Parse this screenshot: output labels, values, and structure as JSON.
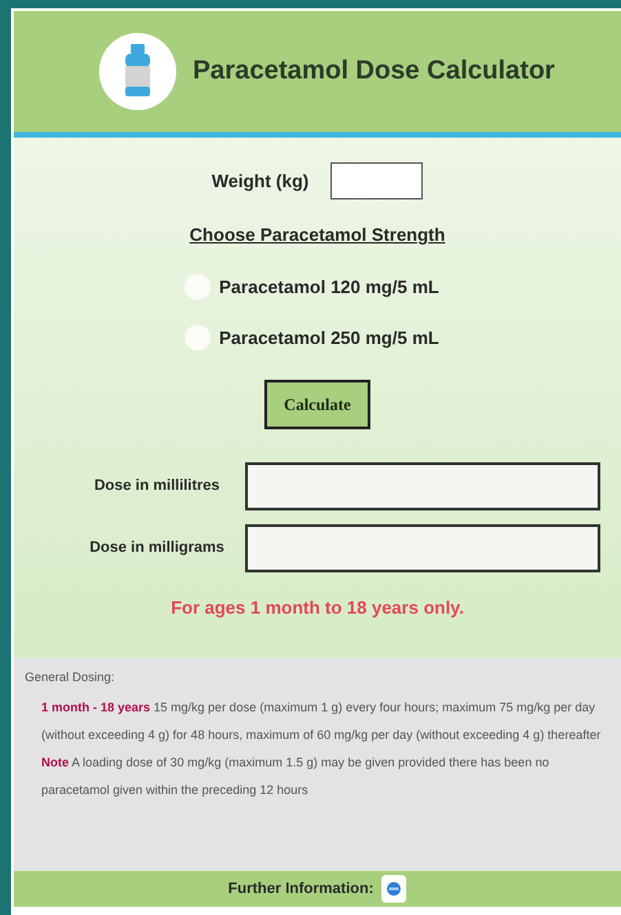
{
  "header": {
    "title": "Paracetamol Dose Calculator"
  },
  "weight": {
    "label": "Weight (kg)"
  },
  "strength": {
    "heading": "Choose Paracetamol Strength",
    "options": [
      {
        "label": "Paracetamol 120 mg/5 mL",
        "selected": false
      },
      {
        "label": "Paracetamol 250 mg/5 mL",
        "selected": false
      }
    ]
  },
  "calculate_button": "Calculate",
  "results": [
    {
      "label": "Dose in millilitres"
    },
    {
      "label": "Dose in milligrams"
    }
  ],
  "age_warning": "For ages 1 month to 18 years only.",
  "dosing": {
    "heading": "General Dosing:",
    "notes": [
      {
        "lead": "1 month - 18 years",
        "text": "15 mg/kg per dose (maximum 1 g) every four hours; maximum 75 mg/kg per day (without exceeding 4 g) for 48 hours, maximum of 60 mg/kg per day (without exceeding 4 g) thereafter"
      },
      {
        "lead": "Note",
        "text": "A loading dose of 30 mg/kg (maximum 1.5 g) may be given provided there has been no paracetamol given within the preceding 12 hours"
      }
    ]
  },
  "footer": {
    "label": "Further Information:"
  }
}
